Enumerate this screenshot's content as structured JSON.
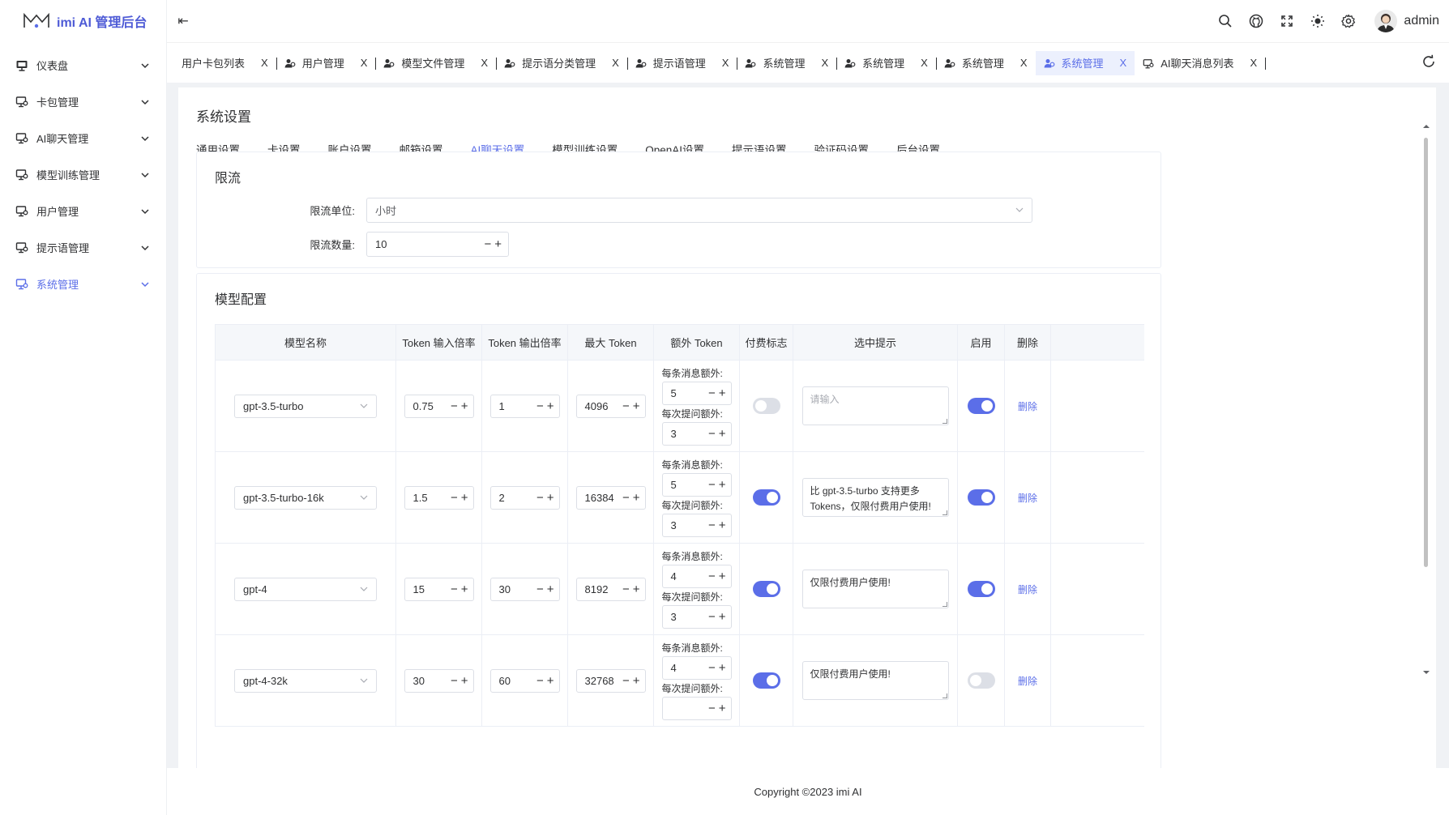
{
  "app": {
    "title": "imi AI 管理后台"
  },
  "sidebar": {
    "items": [
      {
        "label": "仪表盘",
        "icon": "dashboard-icon"
      },
      {
        "label": "卡包管理",
        "icon": "monitor-icon"
      },
      {
        "label": "AI聊天管理",
        "icon": "monitor-icon"
      },
      {
        "label": "模型训练管理",
        "icon": "monitor-icon"
      },
      {
        "label": "用户管理",
        "icon": "monitor-icon"
      },
      {
        "label": "提示语管理",
        "icon": "monitor-icon"
      },
      {
        "label": "系统管理",
        "icon": "monitor-icon",
        "active": true
      }
    ]
  },
  "header": {
    "user_name": "admin",
    "collapse_glyph": "⇤"
  },
  "tabs": [
    {
      "label": "用户卡包列表",
      "close": "X"
    },
    {
      "label": "用户管理",
      "close": "X"
    },
    {
      "label": "模型文件管理",
      "close": "X"
    },
    {
      "label": "提示语分类管理",
      "close": "X"
    },
    {
      "label": "提示语管理",
      "close": "X"
    },
    {
      "label": "系统管理",
      "close": "X"
    },
    {
      "label": "系统管理",
      "close": "X"
    },
    {
      "label": "系统管理",
      "close": "X"
    },
    {
      "label": "系统管理",
      "close": "X",
      "active": true
    },
    {
      "label": "AI聊天消息列表",
      "close": "X"
    }
  ],
  "page": {
    "title": "系统设置",
    "subtabs": [
      "通用设置",
      "卡设置",
      "账户设置",
      "邮箱设置",
      "AI聊天设置",
      "模型训练设置",
      "OpenAI设置",
      "提示语设置",
      "验证码设置",
      "后台设置"
    ],
    "active_subtab": 4
  },
  "rate_limit": {
    "title": "限流",
    "unit_label": "限流单位:",
    "unit_value": "小时",
    "count_label": "限流数量:",
    "count_value": "10"
  },
  "models": {
    "title": "模型配置",
    "columns": [
      "模型名称",
      "Token 输入倍率",
      "Token 输出倍率",
      "最大 Token",
      "额外 Token",
      "付费标志",
      "选中提示",
      "启用",
      "删除"
    ],
    "extra_msg_label": "每条消息额外:",
    "extra_q_label": "每次提问额外:",
    "delete_label": "删除",
    "rows": [
      {
        "name": "gpt-3.5-turbo",
        "in": "0.75",
        "out": "1",
        "max": "4096",
        "extra_msg": "5",
        "extra_q": "3",
        "paid": false,
        "tip": "",
        "tip_placeholder": "请输入",
        "enabled": true
      },
      {
        "name": "gpt-3.5-turbo-16k",
        "in": "1.5",
        "out": "2",
        "max": "16384",
        "extra_msg": "5",
        "extra_q": "3",
        "paid": true,
        "tip": "比 gpt-3.5-turbo 支持更多 Tokens，仅限付费用户使用!",
        "enabled": true
      },
      {
        "name": "gpt-4",
        "in": "15",
        "out": "30",
        "max": "8192",
        "extra_msg": "4",
        "extra_q": "3",
        "paid": true,
        "tip": "仅限付费用户使用!",
        "enabled": true
      },
      {
        "name": "gpt-4-32k",
        "in": "30",
        "out": "60",
        "max": "32768",
        "extra_msg": "4",
        "extra_q": "",
        "paid": true,
        "tip": "仅限付费用户使用!",
        "enabled": false
      }
    ]
  },
  "footer": {
    "copyright": "Copyright ©2023 imi AI"
  },
  "colors": {
    "accent": "#5b6ee8",
    "border": "#dcdfe6"
  }
}
